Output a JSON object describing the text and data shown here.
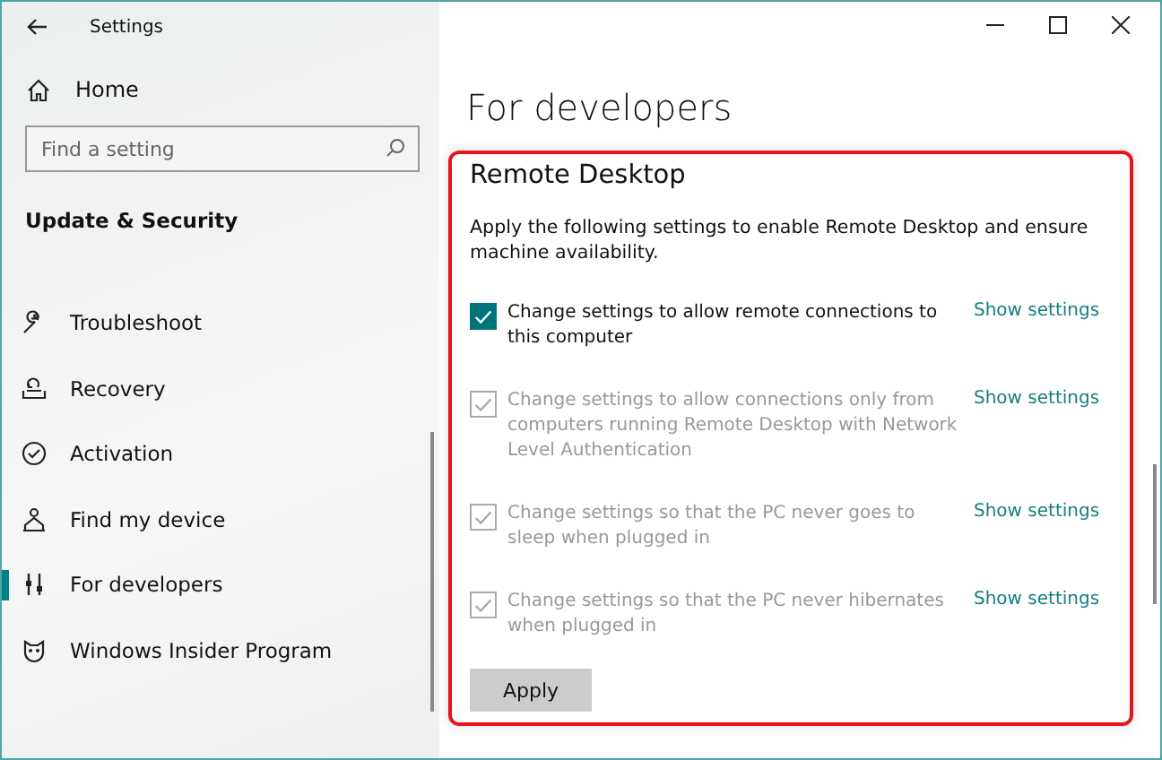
{
  "window": {
    "title": "Settings"
  },
  "sidebar": {
    "home": "Home",
    "search": {
      "placeholder": "Find a setting"
    },
    "section": "Update & Security",
    "items": [
      {
        "label": "Troubleshoot",
        "selected": false
      },
      {
        "label": "Recovery",
        "selected": false
      },
      {
        "label": "Activation",
        "selected": false
      },
      {
        "label": "Find my device",
        "selected": false
      },
      {
        "label": "For developers",
        "selected": true
      },
      {
        "label": "Windows Insider Program",
        "selected": false
      }
    ]
  },
  "page": {
    "title": "For developers",
    "section": {
      "title": "Remote Desktop",
      "description": "Apply the following settings to enable Remote Desktop and ensure machine availability.",
      "options": [
        {
          "label": "Change settings to allow remote connections to this computer",
          "checked": true,
          "disabled": false,
          "link": "Show settings"
        },
        {
          "label": "Change settings to allow connections only from computers running Remote Desktop with Network Level Authentication",
          "checked": true,
          "disabled": true,
          "link": "Show settings"
        },
        {
          "label": "Change settings so that the PC never goes to sleep when plugged in",
          "checked": true,
          "disabled": true,
          "link": "Show settings"
        },
        {
          "label": "Change settings so that the PC never hibernates when plugged in",
          "checked": true,
          "disabled": true,
          "link": "Show settings"
        }
      ],
      "button": "Apply"
    }
  }
}
